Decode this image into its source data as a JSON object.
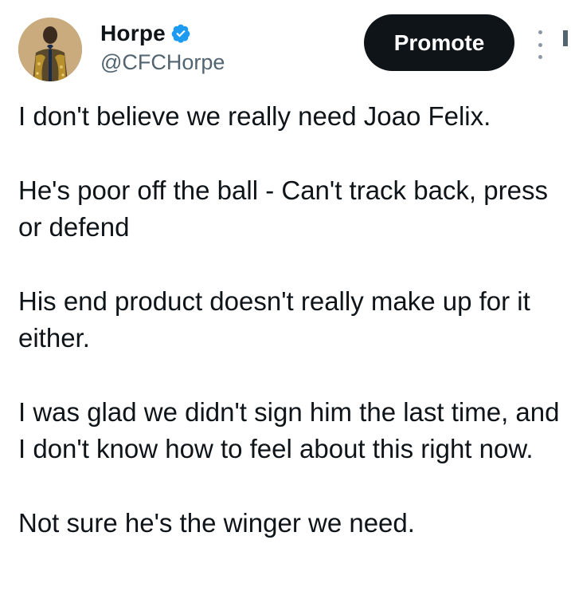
{
  "author": {
    "display_name": "Horpe",
    "handle": "@CFCHorpe",
    "verified": true,
    "verified_icon": "verified-badge-icon"
  },
  "actions": {
    "promote_label": "Promote",
    "more_icon": "more-vertical-icon"
  },
  "tweet": {
    "paragraphs": [
      "I don't believe we really need Joao Felix.",
      "He's poor off the ball - Can't track back, press or defend",
      "His end product doesn't really make up for it either.",
      "I was glad we didn't sign him the last time, and I don't know how to feel about this right now.",
      "Not sure he's the winger we need."
    ]
  },
  "colors": {
    "text": "#0f1419",
    "secondary": "#536471",
    "verified": "#1d9bf0",
    "button_bg": "#0f1419",
    "button_text": "#ffffff"
  }
}
